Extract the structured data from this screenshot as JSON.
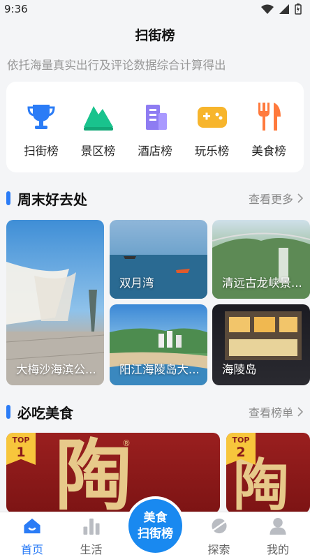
{
  "status": {
    "time": "9:36"
  },
  "header": {
    "title": "扫街榜",
    "subtitle": "依托海量真实出行及评论数据综合计算得出"
  },
  "categories": [
    {
      "label": "扫街榜",
      "icon": "trophy-icon"
    },
    {
      "label": "景区榜",
      "icon": "mountain-icon"
    },
    {
      "label": "酒店榜",
      "icon": "hotel-building-icon"
    },
    {
      "label": "玩乐榜",
      "icon": "gamepad-icon"
    },
    {
      "label": "美食榜",
      "icon": "fork-knife-icon"
    }
  ],
  "weekend": {
    "title": "周末好去处",
    "more": "查看更多",
    "places": [
      {
        "label": "大梅沙海滨公..."
      },
      {
        "label": "双月湾"
      },
      {
        "label": "清远古龙峡景..."
      },
      {
        "label": "阳江海陵岛大..."
      },
      {
        "label": "海陵岛"
      }
    ]
  },
  "food": {
    "title": "必吃美食",
    "more": "查看榜单",
    "cards": [
      {
        "badge_top": "TOP",
        "badge_rank": "1",
        "glyph": "陶"
      },
      {
        "badge_top": "TOP",
        "badge_rank": "2",
        "glyph": "陶"
      }
    ]
  },
  "nav": {
    "items": [
      {
        "label": "首页",
        "icon": "home-icon"
      },
      {
        "label": "生活",
        "icon": "bar-chart-icon"
      },
      {
        "label": "探索",
        "icon": "planet-icon"
      },
      {
        "label": "我的",
        "icon": "user-icon"
      }
    ],
    "center_line1": "美食",
    "center_line2": "扫街榜"
  },
  "colors": {
    "accent": "#2b7cf6",
    "center_button": "#1989f0"
  }
}
